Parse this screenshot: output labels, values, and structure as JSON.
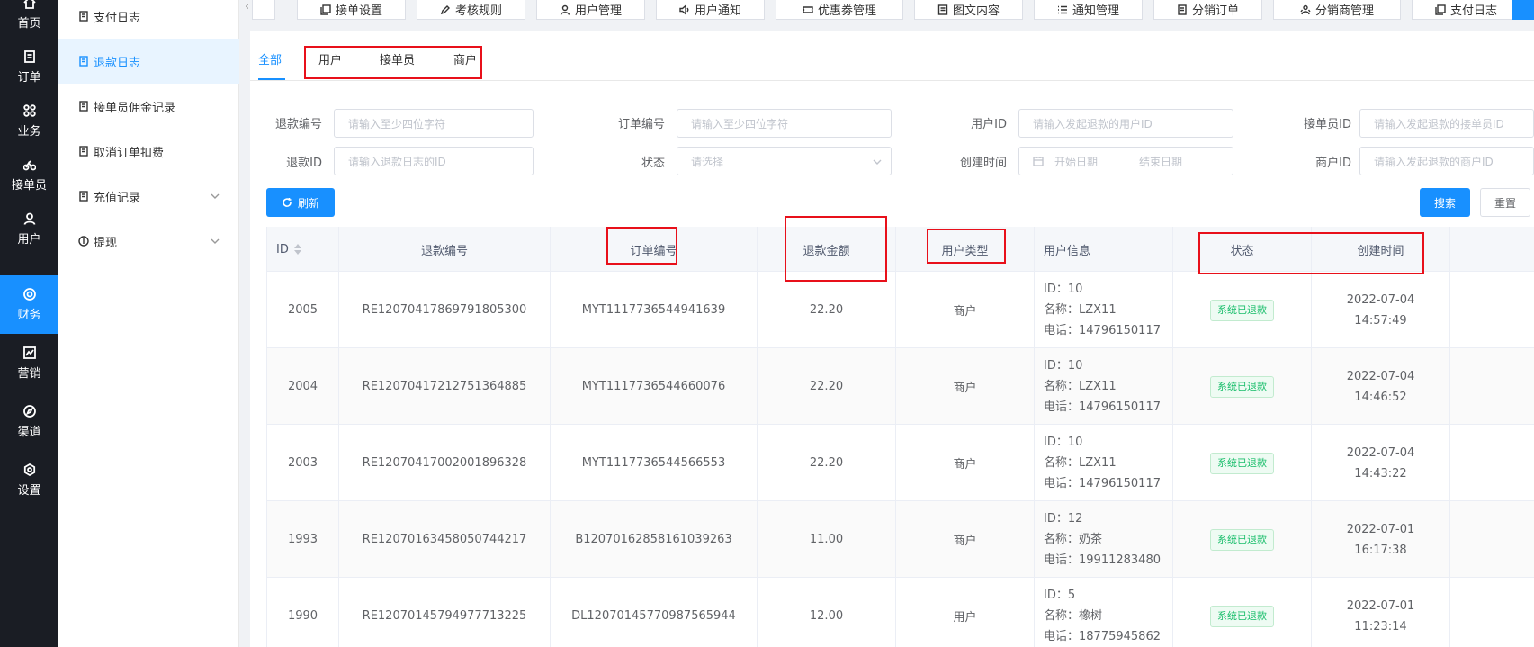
{
  "nav": {
    "items": [
      {
        "label": "首页",
        "icon": "home-icon"
      },
      {
        "label": "订单",
        "icon": "order-icon"
      },
      {
        "label": "业务",
        "icon": "grid-icon"
      },
      {
        "label": "接单员",
        "icon": "bike-icon"
      },
      {
        "label": "用户",
        "icon": "user-icon"
      },
      {
        "label": "财务",
        "icon": "finance-icon"
      },
      {
        "label": "营销",
        "icon": "chart-icon"
      },
      {
        "label": "渠道",
        "icon": "compass-icon"
      },
      {
        "label": "设置",
        "icon": "gear-icon"
      }
    ]
  },
  "submenu": {
    "items": [
      {
        "label": "支付日志"
      },
      {
        "label": "退款日志"
      },
      {
        "label": "接单员佣金记录"
      },
      {
        "label": "取消订单扣费"
      },
      {
        "label": "充值记录"
      },
      {
        "label": "提现"
      }
    ]
  },
  "topbar": {
    "tabs": [
      {
        "label": "接单设置"
      },
      {
        "label": "考核规则"
      },
      {
        "label": "用户管理"
      },
      {
        "label": "用户通知"
      },
      {
        "label": "优惠劵管理"
      },
      {
        "label": "图文内容"
      },
      {
        "label": "通知管理"
      },
      {
        "label": "分销订单"
      },
      {
        "label": "分销商管理"
      },
      {
        "label": "支付日志"
      }
    ]
  },
  "tabs": {
    "all": "全部",
    "user": "用户",
    "courier": "接单员",
    "merchant": "商户"
  },
  "filters": {
    "refund_no": {
      "label": "退款编号",
      "placeholder": "请输入至少四位字符"
    },
    "order_no": {
      "label": "订单编号",
      "placeholder": "请输入至少四位字符"
    },
    "user_id": {
      "label": "用户ID",
      "placeholder": "请输入发起退款的用户ID"
    },
    "courier_id": {
      "label": "接单员ID",
      "placeholder": "请输入发起退款的接单员ID"
    },
    "refund_id": {
      "label": "退款ID",
      "placeholder": "请输入退款日志的ID"
    },
    "status": {
      "label": "状态",
      "placeholder": "请选择"
    },
    "created": {
      "label": "创建时间",
      "start": "开始日期",
      "end": "结束日期"
    },
    "merchant_id": {
      "label": "商户ID",
      "placeholder": "请输入发起退款的商户ID"
    }
  },
  "buttons": {
    "refresh": "刷新",
    "search": "搜索",
    "reset": "重置"
  },
  "table": {
    "headers": {
      "id": "ID",
      "refund_no": "退款编号",
      "order_no": "订单编号",
      "amount": "退款金额",
      "user_type": "用户类型",
      "user_info": "用户信息",
      "status": "状态",
      "created": "创建时间"
    },
    "rows": [
      {
        "id": "2005",
        "refund_no": "RE12070417869791805300",
        "order_no": "MYT1117736544941639",
        "amount": "22.20",
        "user_type": "商户",
        "info_id": "ID：10",
        "info_name": "名称：LZX11",
        "info_phone": "电话：14796150117",
        "status": "系统已退款",
        "created": "2022-07-04 14:57:49"
      },
      {
        "id": "2004",
        "refund_no": "RE12070417212751364885",
        "order_no": "MYT1117736544660076",
        "amount": "22.20",
        "user_type": "商户",
        "info_id": "ID：10",
        "info_name": "名称：LZX11",
        "info_phone": "电话：14796150117",
        "status": "系统已退款",
        "created": "2022-07-04 14:46:52"
      },
      {
        "id": "2003",
        "refund_no": "RE12070417002001896328",
        "order_no": "MYT1117736544566553",
        "amount": "22.20",
        "user_type": "商户",
        "info_id": "ID：10",
        "info_name": "名称：LZX11",
        "info_phone": "电话：14796150117",
        "status": "系统已退款",
        "created": "2022-07-04 14:43:22"
      },
      {
        "id": "1993",
        "refund_no": "RE12070163458050744217",
        "order_no": "B12070162858161039263",
        "amount": "11.00",
        "user_type": "商户",
        "info_id": "ID：12",
        "info_name": "名称：奶茶",
        "info_phone": "电话：19911283480",
        "status": "系统已退款",
        "created": "2022-07-01 16:17:38"
      },
      {
        "id": "1990",
        "refund_no": "RE12070145794977713225",
        "order_no": "DL12070145770987565944",
        "amount": "12.00",
        "user_type": "用户",
        "info_id": "ID：5",
        "info_name": "名称：橡树",
        "info_phone": "电话：18775945862",
        "status": "系统已退款",
        "created": "2022-07-01 11:23:14"
      }
    ]
  },
  "colors": {
    "nav_bg": "#1a1d24",
    "accent": "#1890ff",
    "annotation_red": "#e8101a",
    "success_green": "#19be6b"
  }
}
